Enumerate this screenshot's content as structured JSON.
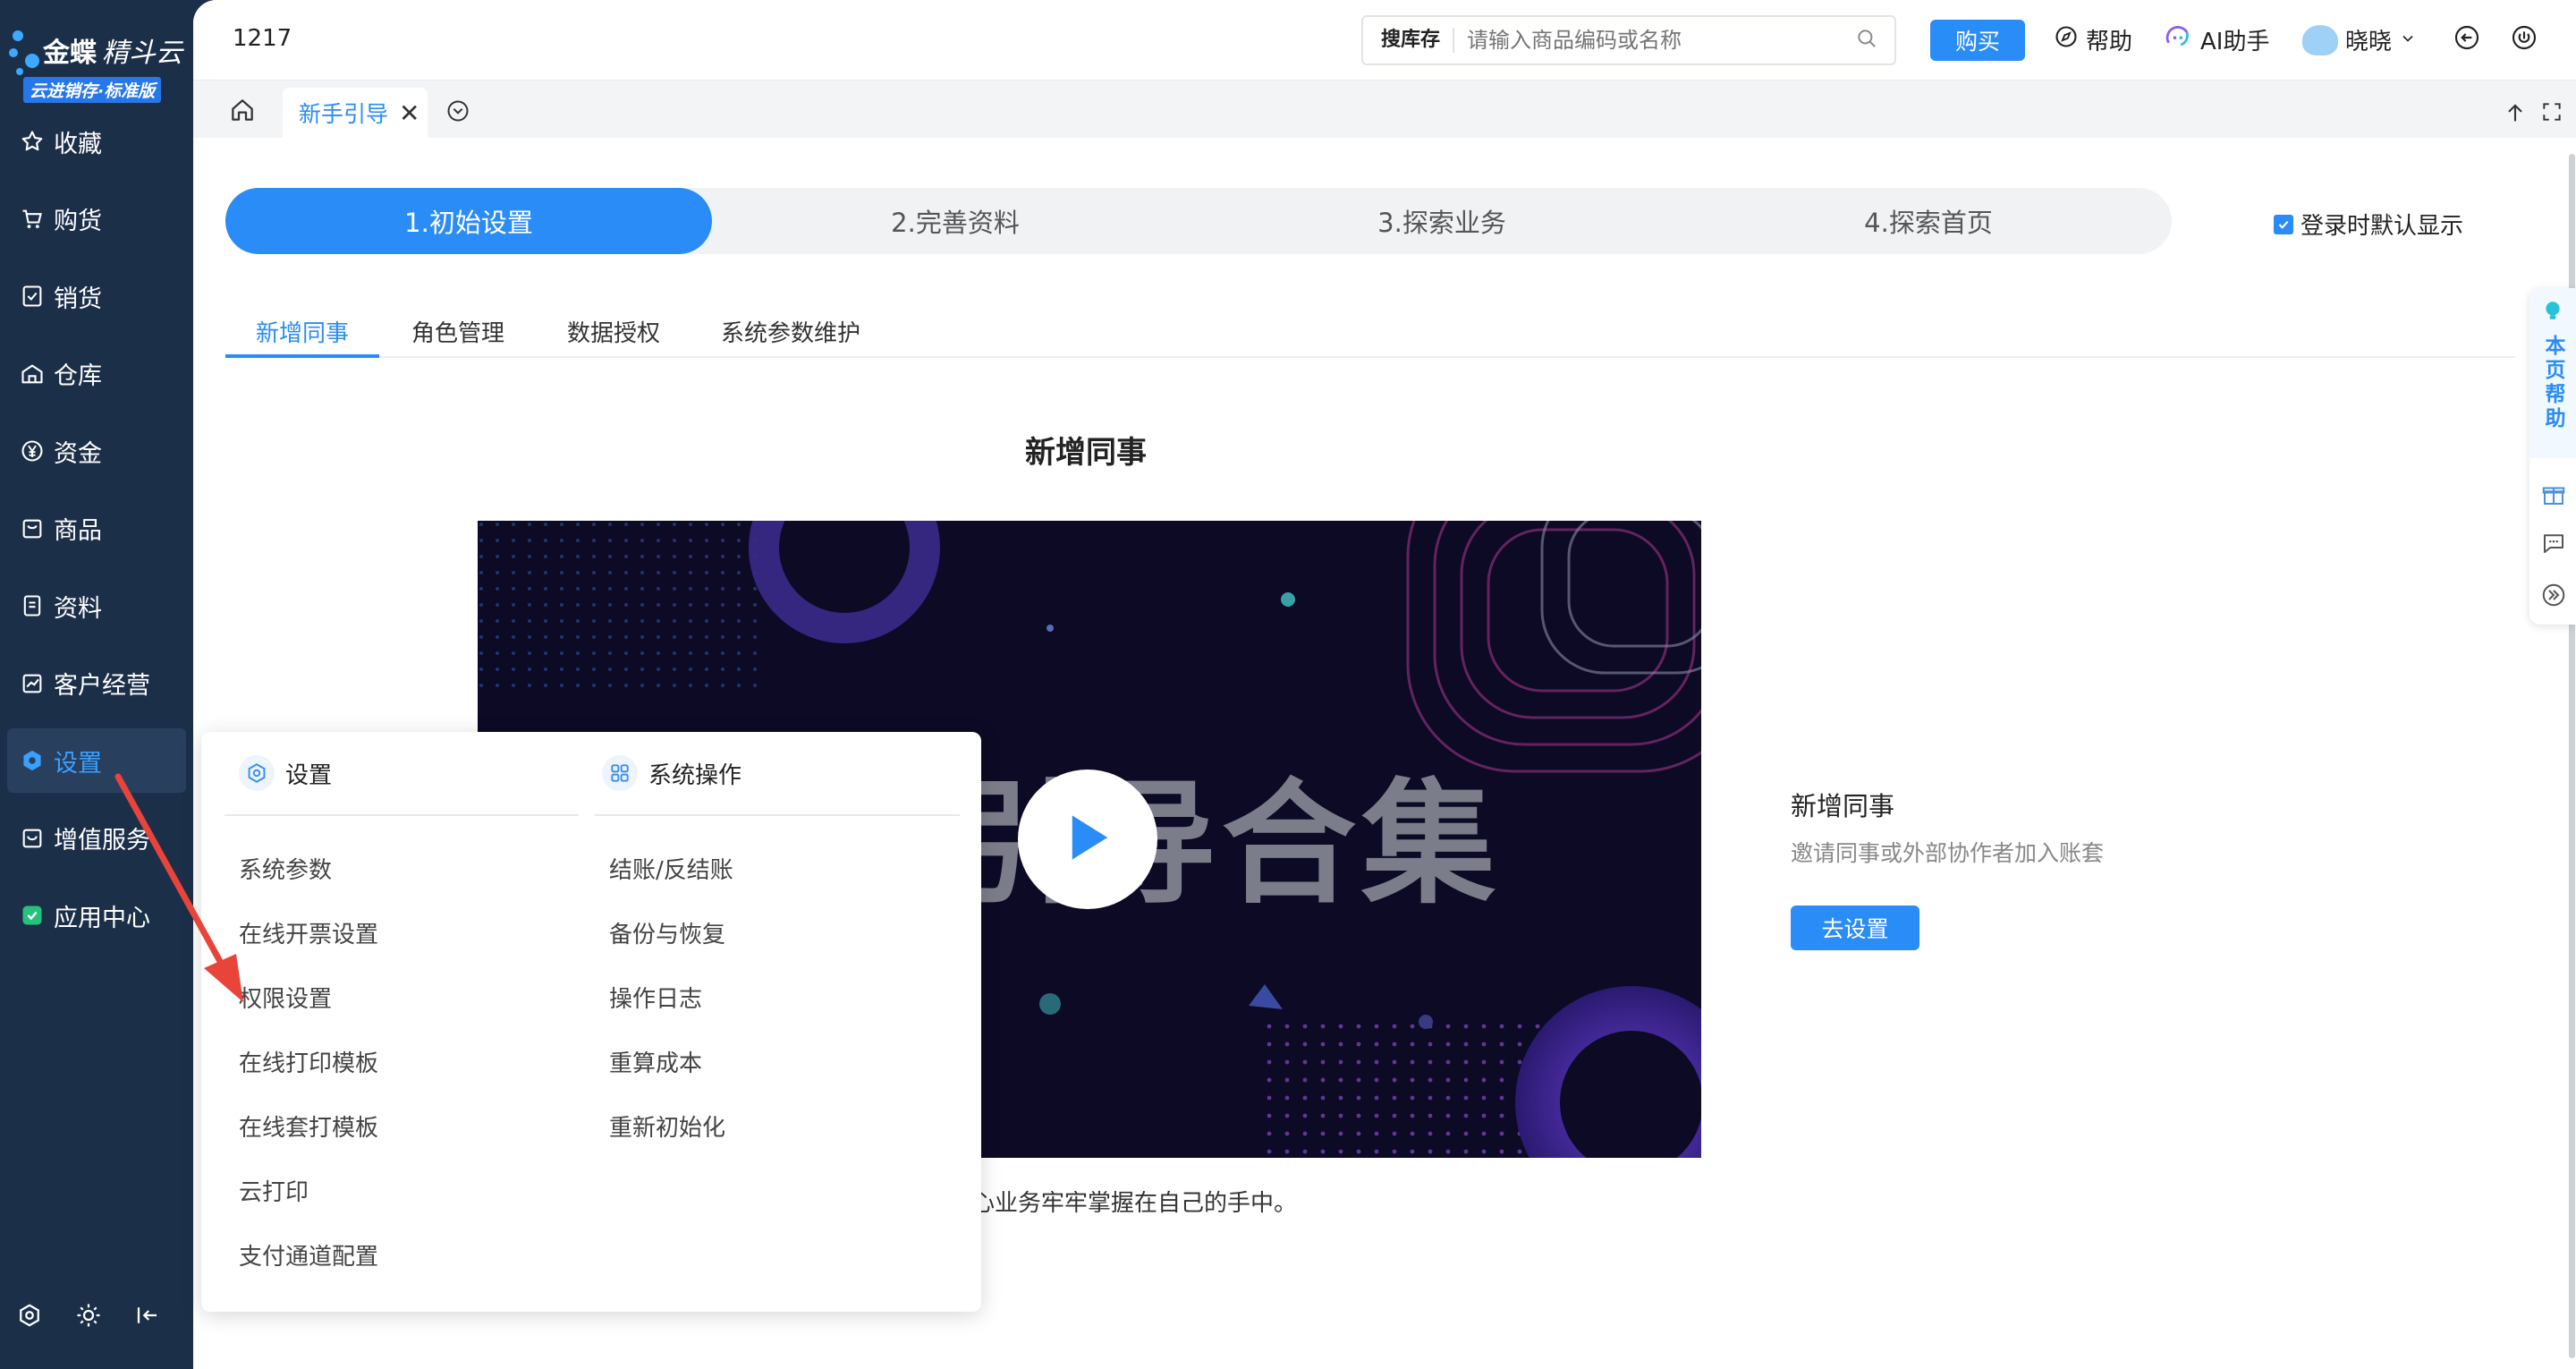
{
  "brand": {
    "name": "金蝶",
    "product": "精斗云",
    "edition": "云进销存·标准版"
  },
  "sidebar": {
    "items": [
      {
        "label": "收藏",
        "icon": "star-icon"
      },
      {
        "label": "购货",
        "icon": "cart-icon"
      },
      {
        "label": "销货",
        "icon": "sales-doc-icon"
      },
      {
        "label": "仓库",
        "icon": "warehouse-icon"
      },
      {
        "label": "资金",
        "icon": "yuan-icon"
      },
      {
        "label": "商品",
        "icon": "goods-icon"
      },
      {
        "label": "资料",
        "icon": "document-icon"
      },
      {
        "label": "客户经营",
        "icon": "trend-chart-icon"
      },
      {
        "label": "设置",
        "icon": "settings-gear-icon",
        "active": true
      },
      {
        "label": "增值服务",
        "icon": "value-added-icon"
      },
      {
        "label": "应用中心",
        "icon": "app-center-icon"
      }
    ],
    "bottom_icons": [
      "settings-icon",
      "theme-sun-icon",
      "collapse-sidebar-icon"
    ]
  },
  "topbar": {
    "account_id": "1217",
    "search_scope": "搜库存",
    "search_placeholder": "请输入商品编码或名称",
    "buy_label": "购买",
    "help_label": "帮助",
    "ai_label": "AI助手",
    "user_name": "晓晓"
  },
  "tabs": {
    "active_tab": "新手引导"
  },
  "steps": [
    {
      "label": "1.初始设置",
      "active": true
    },
    {
      "label": "2.完善资料"
    },
    {
      "label": "3.探索业务"
    },
    {
      "label": "4.探索首页"
    }
  ],
  "login_default_label": "登录时默认显示",
  "login_default_checked": true,
  "subtabs": [
    {
      "label": "新增同事",
      "active": true
    },
    {
      "label": "角色管理"
    },
    {
      "label": "数据授权"
    },
    {
      "label": "系统参数维护"
    }
  ],
  "content": {
    "section_title": "新增同事",
    "video_overlay_text": "引导合集",
    "caption": "心业务牢牢掌握在自己的手中。",
    "info_title": "新增同事",
    "info_desc": "邀请同事或外部协作者加入账套",
    "go_button": "去设置"
  },
  "float_help": {
    "label": "本页帮助"
  },
  "popup": {
    "col1_title": "设置",
    "col1_items": [
      "系统参数",
      "在线开票设置",
      "权限设置",
      "在线打印模板",
      "在线套打模板",
      "云打印",
      "支付通道配置"
    ],
    "col2_title": "系统操作",
    "col2_items": [
      "结账/反结账",
      "备份与恢复",
      "操作日志",
      "重算成本",
      "重新初始化"
    ]
  },
  "colors": {
    "sidebar_bg": "#1c2f49",
    "accent": "#2a8cf6",
    "annotation_arrow": "#e8443a"
  }
}
